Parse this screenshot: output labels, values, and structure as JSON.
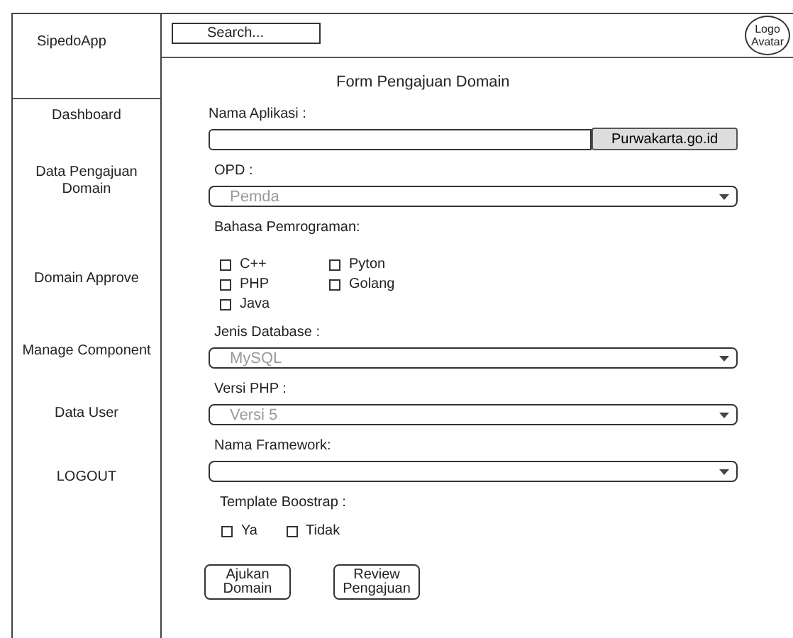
{
  "sidebar": {
    "brand": "SipedoApp",
    "items": [
      {
        "label": "Dashboard"
      },
      {
        "label": "Data Pengajuan Domain"
      },
      {
        "label": "Domain Approve"
      },
      {
        "label": "Manage Component"
      },
      {
        "label": "Data User"
      },
      {
        "label": "LOGOUT"
      }
    ]
  },
  "header": {
    "search": {
      "placeholder": "Search..."
    },
    "avatar": {
      "line1": "Logo",
      "line2": "Avatar"
    }
  },
  "form": {
    "title": "Form Pengajuan Domain",
    "fields": [
      {
        "kind": "text_addon",
        "label": "Nama Aplikasi :",
        "addon": "Purwakarta.go.id"
      },
      {
        "kind": "select",
        "label": "OPD :",
        "value": "Pemda"
      },
      {
        "kind": "checks",
        "label": "Bahasa Pemrograman:",
        "options": [
          {
            "label": "C++",
            "checked": false
          },
          {
            "label": "Pyton",
            "checked": false
          },
          {
            "label": "PHP",
            "checked": false
          },
          {
            "label": "Golang",
            "checked": false
          },
          {
            "label": "Java",
            "checked": false
          }
        ]
      },
      {
        "kind": "select",
        "label": "Jenis Database :",
        "value": "MySQL"
      },
      {
        "kind": "select",
        "label": "Versi PHP :",
        "value": "Versi 5"
      },
      {
        "kind": "select",
        "label": "Nama Framework:"
      },
      {
        "kind": "inline_checks",
        "label": "Template Boostrap :",
        "options": [
          {
            "label": "Ya",
            "checked": false
          },
          {
            "label": "Tidak",
            "checked": false
          }
        ]
      }
    ],
    "buttons": [
      {
        "label": "Ajukan Domain"
      },
      {
        "label": "Review Pengajuan"
      }
    ]
  }
}
